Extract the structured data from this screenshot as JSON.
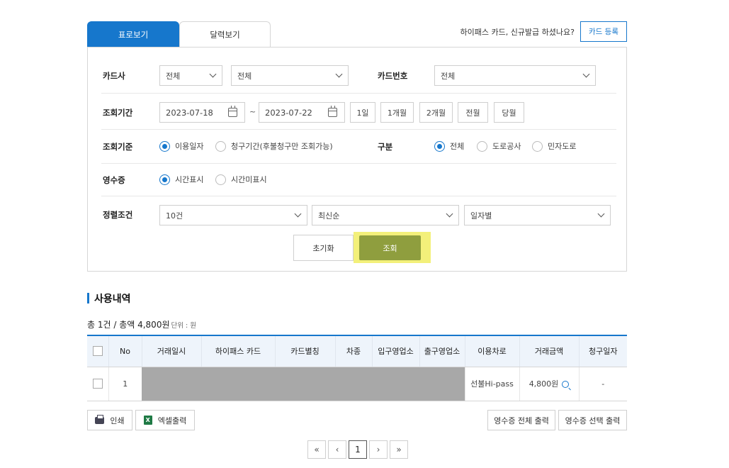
{
  "tabs": {
    "table_view": "표로보기",
    "calendar_view": "달력보기"
  },
  "notice": "하이패스 카드, 신규발급 하셨나요?",
  "card_register_button": "카드 등록",
  "search": {
    "card_company_label": "카드사",
    "card_company_value": "전체",
    "card_company_sub_value": "전체",
    "card_number_label": "카드번호",
    "card_number_value": "전체",
    "period_label": "조회기간",
    "start_date": "2023-07-18",
    "date_separator": "~",
    "end_date": "2023-07-22",
    "period_buttons": [
      "1일",
      "1개월",
      "2개월",
      "전월",
      "당월"
    ],
    "basis_label": "조회기준",
    "basis_options": [
      "이용일자",
      "청구기간(후불청구만 조회가능)"
    ],
    "basis_selected": "이용일자",
    "category_label": "구분",
    "category_options": [
      "전체",
      "도로공사",
      "민자도로"
    ],
    "category_selected": "전체",
    "receipt_label": "영수증",
    "receipt_options": [
      "시간표시",
      "시간미표시"
    ],
    "receipt_selected": "시간표시",
    "sort_label": "정렬조건",
    "sort_count": "10건",
    "sort_order": "최신순",
    "sort_by": "일자별",
    "reset_button": "초기화",
    "search_button": "조회"
  },
  "section_title": "사용내역",
  "summary": {
    "text": "총 1건 / 총액 4,800원",
    "unit": "단위 : 원"
  },
  "table": {
    "headers": [
      "",
      "No",
      "거래일시",
      "하이패스 카드",
      "카드별칭",
      "차종",
      "입구영업소",
      "출구영업소",
      "이용차로",
      "거래금액",
      "청구일자"
    ],
    "rows": [
      {
        "no": "1",
        "lane": "선불Hi-pass",
        "amount": "4,800원",
        "billing_date": "-"
      }
    ]
  },
  "buttons": {
    "print": "인쇄",
    "excel": "엑셀출력",
    "receipt_all": "영수증 전체 출력",
    "receipt_selected": "영수증 선택 출력"
  },
  "pagination": {
    "first": "«",
    "prev": "‹",
    "current": "1",
    "next": "›",
    "last": "»"
  },
  "colors": {
    "accent": "#1677cc",
    "search_button": "#8f9e3e",
    "highlight": "#f3f07a",
    "mask": "#a8a8a8"
  }
}
